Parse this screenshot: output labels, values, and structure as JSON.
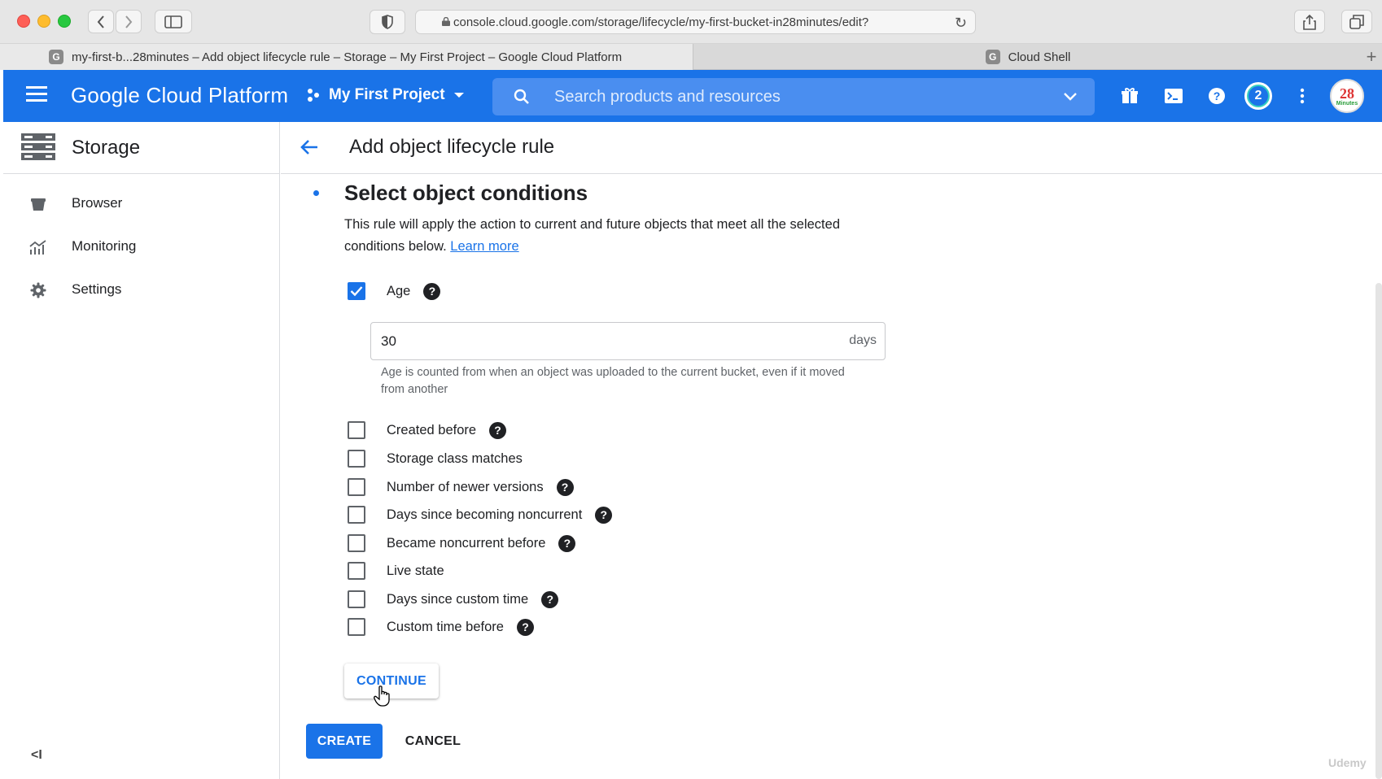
{
  "browser": {
    "url": "console.cloud.google.com/storage/lifecycle/my-first-bucket-in28minutes/edit?",
    "tabs": [
      {
        "title": "my-first-b...28minutes – Add object lifecycle rule – Storage – My First Project – Google Cloud Platform",
        "favicon": "G",
        "active": true
      },
      {
        "title": "Cloud Shell",
        "favicon": "G",
        "active": false
      }
    ]
  },
  "header": {
    "brand": "Google Cloud Platform",
    "project": "My First Project",
    "search_placeholder": "Search products and resources",
    "notifications": "2",
    "avatar_text": "28",
    "avatar_sub": "Minutes",
    "brand_color": "#1a73e8"
  },
  "sidebar": {
    "title": "Storage",
    "items": [
      {
        "label": "Browser",
        "icon": "bucket-icon"
      },
      {
        "label": "Monitoring",
        "icon": "chart-icon"
      },
      {
        "label": "Settings",
        "icon": "gear-icon"
      }
    ],
    "collapse_label": "<I"
  },
  "main": {
    "page_title": "Add object lifecycle rule",
    "section_title": "Select object conditions",
    "description": "This rule will apply the action to current and future objects that meet all the selected conditions below.",
    "learn_more": "Learn more",
    "age": {
      "label": "Age",
      "checked": true,
      "value": "30",
      "suffix": "days",
      "hint": "Age is counted from when an object was uploaded to the current bucket, even if it moved from another"
    },
    "conditions": [
      {
        "label": "Created before",
        "help": true,
        "checked": false
      },
      {
        "label": "Storage class matches",
        "help": false,
        "checked": false
      },
      {
        "label": "Number of newer versions",
        "help": true,
        "checked": false
      },
      {
        "label": "Days since becoming noncurrent",
        "help": true,
        "checked": false
      },
      {
        "label": "Became noncurrent before",
        "help": true,
        "checked": false
      },
      {
        "label": "Live state",
        "help": false,
        "checked": false
      },
      {
        "label": "Days since custom time",
        "help": true,
        "checked": false
      },
      {
        "label": "Custom time before",
        "help": true,
        "checked": false
      }
    ],
    "continue_label": "CONTINUE",
    "create_label": "CREATE",
    "cancel_label": "CANCEL"
  },
  "watermark": "Udemy"
}
